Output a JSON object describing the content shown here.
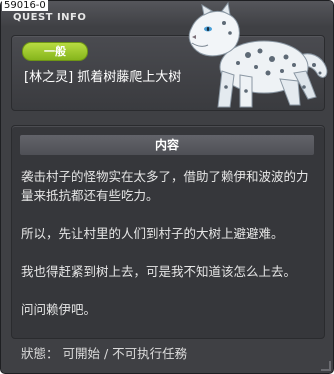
{
  "window": {
    "quest_id": "59016-0",
    "title": "QUEST INFO"
  },
  "summary": {
    "category": "一般",
    "quest_name": "[林之灵] 抓着树藤爬上大树"
  },
  "content": {
    "header": "内容",
    "paragraphs": [
      "袭击村子的怪物实在太多了，借助了赖伊和波波的力量来抵抗都还有些吃力。",
      "所以，先让村里的人们到村子的大树上避避难。",
      "我也得赶紧到树上去，可是我不知道该怎么上去。",
      "问问赖伊吧。"
    ]
  },
  "status": {
    "text": "狀態： 可開始 / 不可执行任務"
  },
  "icons": {
    "npc": "snow-leopard-icon"
  },
  "colors": {
    "badge": "#9ac82d",
    "window_bg": "#3f4044"
  }
}
